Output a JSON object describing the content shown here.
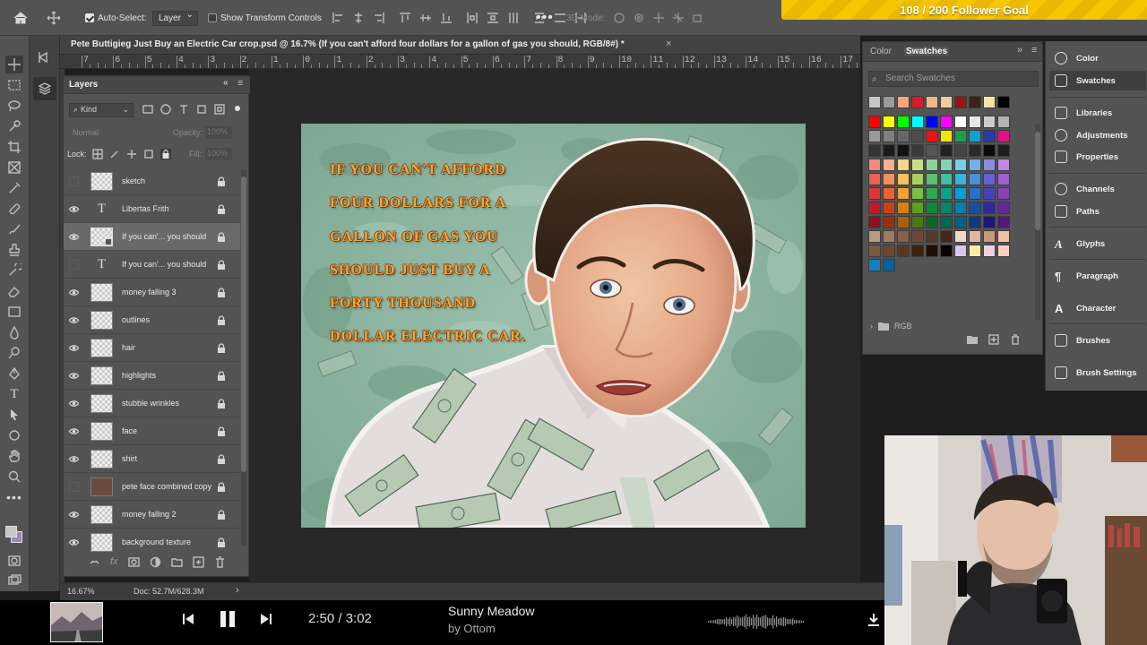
{
  "options_bar": {
    "auto_select_label": "Auto-Select:",
    "layer_select_value": "Layer",
    "transform_controls_label": "Show Transform Controls",
    "mode_3d_label": "3D Mode:"
  },
  "follower_goal": {
    "text": "108 / 200 Follower Goal"
  },
  "document": {
    "tab_title": "Pete Buttigieg Just Buy an Electric Car crop.psd @ 16.7% (If you can't afford four dollars for a gallon of gas you should, RGB/8#) *",
    "ruler_labels": [
      "7",
      "6",
      "5",
      "4",
      "3",
      "2",
      "1",
      "0",
      "1",
      "2",
      "3",
      "4",
      "5",
      "6",
      "7",
      "8",
      "9",
      "10",
      "11",
      "12",
      "13",
      "14",
      "15",
      "16",
      "17"
    ],
    "zoom": "16.67%",
    "doc_size": "Doc: 52.7M/628.3M"
  },
  "artwork": {
    "quote_lines": [
      "IF YOU CAN'T AFFORD",
      "FOUR DOLLARS FOR A",
      "GALLON OF GAS YOU",
      "SHOULD JUST BUY A",
      "FORTY THOUSAND",
      "DOLLAR ELECTRIC CAR."
    ]
  },
  "layers_panel": {
    "title": "Layers",
    "filter_kind": "Kind",
    "blend_mode": "Normal",
    "opacity_label": "Opacity:",
    "opacity_value": "100%",
    "lock_label": "Lock:",
    "fill_label": "Fill:",
    "fill_value": "100%",
    "layers": [
      {
        "name": "sketch",
        "visible": false,
        "kind": "pixel",
        "selected": false
      },
      {
        "name": "Libertas Frith",
        "visible": true,
        "kind": "text",
        "selected": false
      },
      {
        "name": "If you can'... you should",
        "visible": true,
        "kind": "smart",
        "selected": true
      },
      {
        "name": "If you can'... you should",
        "visible": false,
        "kind": "text",
        "selected": false
      },
      {
        "name": "money falling 3",
        "visible": true,
        "kind": "pixel",
        "selected": false
      },
      {
        "name": "outlines",
        "visible": true,
        "kind": "pixel",
        "selected": false
      },
      {
        "name": "hair",
        "visible": true,
        "kind": "pixel",
        "selected": false
      },
      {
        "name": "highlights",
        "visible": true,
        "kind": "pixel",
        "selected": false
      },
      {
        "name": "stubble wrinkles",
        "visible": true,
        "kind": "pixel",
        "selected": false
      },
      {
        "name": "face",
        "visible": true,
        "kind": "pixel",
        "selected": false
      },
      {
        "name": "shirt",
        "visible": true,
        "kind": "pixel",
        "selected": false
      },
      {
        "name": "pete face combined copy",
        "visible": false,
        "kind": "photo",
        "selected": false
      },
      {
        "name": "money falling 2",
        "visible": true,
        "kind": "pixel",
        "selected": false
      },
      {
        "name": "background texture",
        "visible": true,
        "kind": "pixel",
        "selected": false
      }
    ]
  },
  "swatches_panel": {
    "tab_color": "Color",
    "tab_swatches": "Swatches",
    "search_placeholder": "Search Swatches",
    "group_label": "RGB"
  },
  "dock": {
    "items": [
      "Color",
      "Swatches",
      "Libraries",
      "Adjustments",
      "Properties",
      "Channels",
      "Paths",
      "Glyphs",
      "Paragraph",
      "Character",
      "Brushes",
      "Brush Settings"
    ]
  },
  "music": {
    "time": "2:50 / 3:02",
    "song": "Sunny Meadow",
    "artist": "by Ottom"
  },
  "colors": {
    "ps_panel": "#535353",
    "ps_dark": "#3b3b3b",
    "goal_yellow": "#f7c600",
    "art_bg": "#8fb8a3",
    "quote_text": "#f0a73a"
  }
}
